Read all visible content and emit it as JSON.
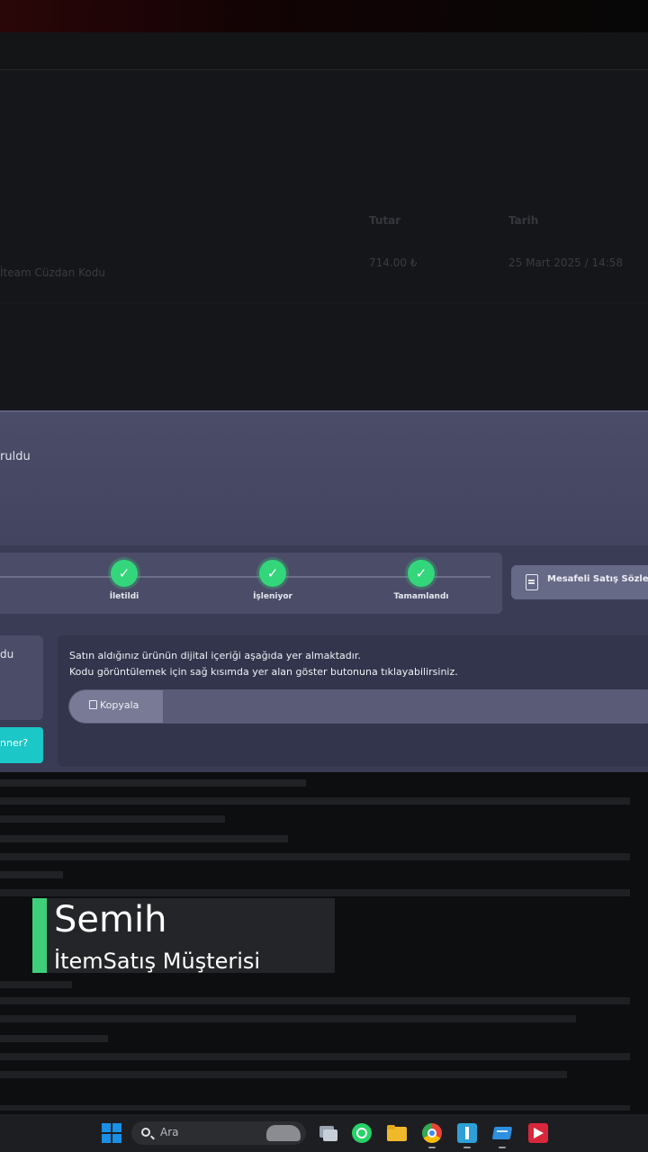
{
  "background_table": {
    "headers": [
      "Tutar",
      "Tarih"
    ],
    "row": {
      "product": "İteam Cüzdan Kodu",
      "amount": "714.00 ₺",
      "date": "25 Mart 2025 / 14:58"
    }
  },
  "modal": {
    "status_fragment": "ruldu",
    "steps": [
      {
        "label": "İletildi",
        "state": "complete"
      },
      {
        "label": "İşleniyor",
        "state": "complete"
      },
      {
        "label": "Tamamlandı",
        "state": "complete"
      }
    ],
    "contract_button": "Mesafeli Satış Sözleşmesi",
    "left_card_fragment": "du",
    "teal_button_fragment": "nner?",
    "info_line_1": "Satın aldığınız ürünün dijital içeriği aşağıda yer almaktadır.",
    "info_line_2": "Kodu görüntülemek için sağ kısımda yer alan göster butonuna tıklayabilirsiniz.",
    "copy_button": "Kopyala"
  },
  "lower_third": {
    "name": "Semih",
    "role": "İtemSatış Müşterisi",
    "accent_color": "#3fcf7b"
  },
  "taskbar": {
    "search_placeholder": "Ara",
    "icons": [
      "windows-start-icon",
      "search-icon",
      "task-view-icon",
      "whatsapp-icon",
      "file-explorer-icon",
      "chrome-icon",
      "app-icon",
      "mail-icon",
      "media-icon"
    ]
  }
}
